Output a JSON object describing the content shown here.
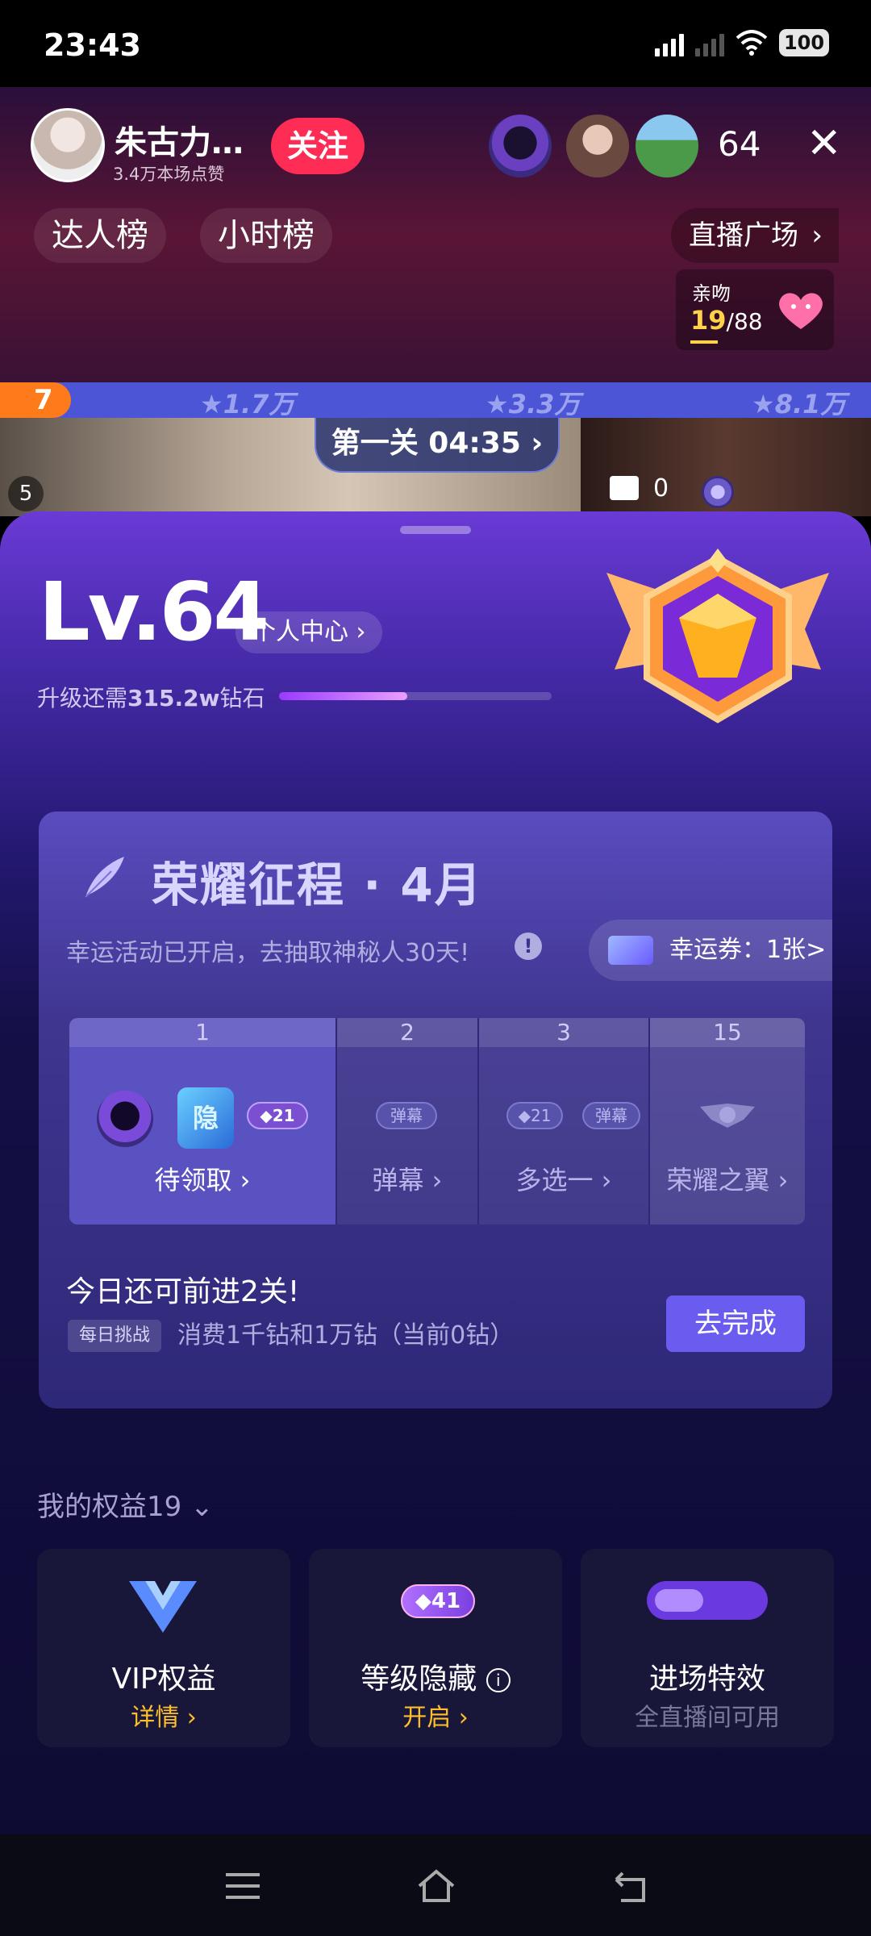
{
  "status": {
    "time": "23:43",
    "network": "5G",
    "battery": "100"
  },
  "live": {
    "host_name": "朱古力…",
    "host_likes": "3.4万本场点赞",
    "follow_label": "关注",
    "viewer_count": "64",
    "tabs": [
      "达人榜",
      "小时榜"
    ],
    "plaza": "直播广场",
    "kiss": {
      "label": "亲吻",
      "current": "19",
      "total": "/88"
    }
  },
  "pk": {
    "rank": "7",
    "values": [
      "1.7万",
      "3.3万",
      "8.1万"
    ]
  },
  "video": {
    "stage": "第一关 04:35 ›",
    "left_num": "5",
    "gift_count": "0"
  },
  "level": {
    "title": "Lv.64",
    "center_label": "个人中心 ›",
    "upgrade_prefix": "升级还需",
    "upgrade_amount": "315.2w",
    "upgrade_suffix": "钻石",
    "progress": 0.47
  },
  "glory": {
    "title": "荣耀征程 · 4月",
    "desc": "幸运活动已开启，去抽取神秘人30天!",
    "ticket": "幸运券：1张>",
    "stages": [
      {
        "num": "1",
        "label": "待领取 ›"
      },
      {
        "num": "2",
        "label": "弹幕 ›"
      },
      {
        "num": "3",
        "label": "多选一 ›"
      },
      {
        "num": "15",
        "label": "荣耀之翼 ›"
      }
    ],
    "chip_hidden": "隐",
    "chip_lv": "21",
    "chip_danmu": "弹幕",
    "today": "今日还可前进2关!",
    "daily_tag": "每日挑战",
    "daily_text": "消费1千钻和1万钻（当前0钻）",
    "go_label": "去完成"
  },
  "rights": {
    "header": "我的权益19",
    "cards": [
      {
        "title": "VIP权益",
        "sub": "详情 ›"
      },
      {
        "title": "等级隐藏",
        "sub": "开启 ›",
        "badge": "41"
      },
      {
        "title": "进场特效",
        "sub": "全直播间可用"
      }
    ]
  },
  "colors": {
    "accent": "#6b5cf0",
    "follow": "#ff2d55",
    "gold": "#ffbf2a"
  }
}
